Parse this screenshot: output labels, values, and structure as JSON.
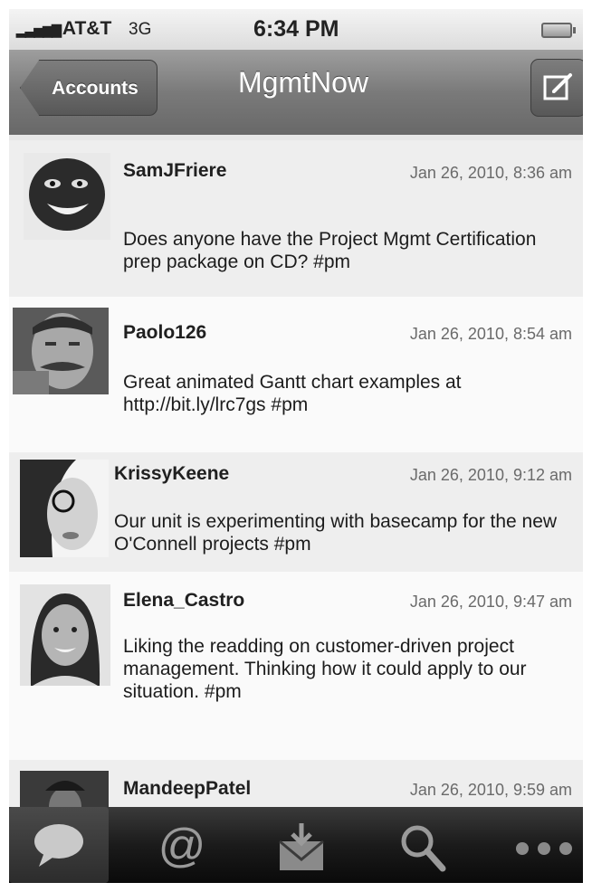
{
  "status_bar": {
    "carrier": "AT&T",
    "network": "3G",
    "time": "6:34 PM"
  },
  "nav_bar": {
    "back_label": "Accounts",
    "title": "MgmtNow"
  },
  "tweets": [
    {
      "user": "SamJFriere",
      "timestamp": "Jan 26, 2010, 8:36 am",
      "text": "Does anyone have the Project Mgmt Certification prep package on CD? #pm"
    },
    {
      "user": "Paolo126",
      "timestamp": "Jan 26, 2010, 8:54 am",
      "text": "Great animated Gantt chart examples at http://bit.ly/lrc7gs  #pm"
    },
    {
      "user": "KrissyKeene",
      "timestamp": "Jan 26, 2010, 9:12 am",
      "text": "Our unit is experimenting with basecamp for the new O'Connell projects #pm"
    },
    {
      "user": "Elena_Castro",
      "timestamp": "Jan 26, 2010, 9:47 am",
      "text": "Liking the readding on customer-driven project management. Thinking how it could apply to our situation.  #pm"
    },
    {
      "user": "MandeepPatel",
      "timestamp": "Jan 26, 2010, 9:59 am",
      "text": ""
    }
  ],
  "tab_bar": {
    "active_tab": "timeline",
    "tabs": [
      "speech-bubble-icon",
      "at-sign-icon",
      "inbox-download-icon",
      "search-icon",
      "more-icon"
    ]
  },
  "colors": {
    "nav_bar": "#7a7a7a",
    "tab_bar": "#1b1b1b",
    "list_bg": "#efefef"
  }
}
